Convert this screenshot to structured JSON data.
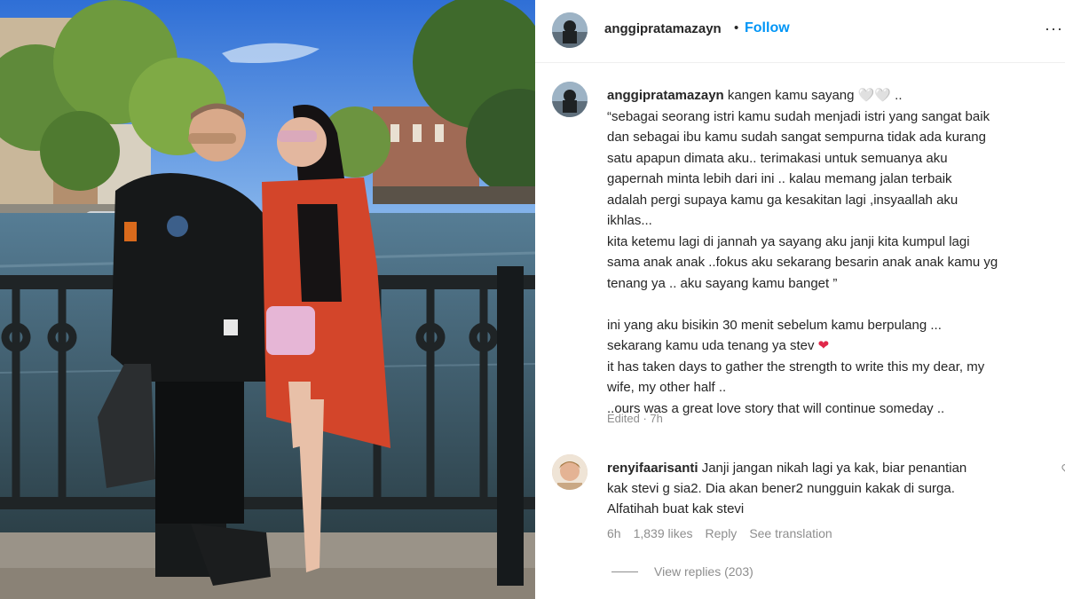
{
  "post": {
    "username": "anggipratamazayn",
    "follow_label": "Follow",
    "separator": "•",
    "more_icon": "more-icon"
  },
  "caption": {
    "username": "anggipratamazayn",
    "text": " kangen kamu sayang 🤍🤍 ..\n“sebagai seorang istri kamu sudah menjadi istri yang sangat baik\ndan sebagai ibu kamu sudah sangat sempurna tidak ada kurang\nsatu apapun dimata aku.. terimakasi untuk semuanya aku\ngapernah minta lebih dari ini .. kalau memang jalan terbaik\nadalah pergi supaya kamu ga kesakitan lagi ,insyaallah aku\nikhlas...\nkita ketemu lagi di jannah ya sayang aku janji kita kumpul lagi\nsama anak anak ..fokus aku sekarang besarin anak anak kamu yg\ntenang ya .. aku sayang kamu banget ”\n\nini yang aku bisikin 30 menit sebelum kamu berpulang ...\nsekarang kamu uda tenang ya stev ",
    "heart": "❤",
    "text_after": "\nit has taken days to gather the strength to write this my dear, my\nwife, my other half ..\n..ours was a great love story that will continue someday ..",
    "edited": "Edited · 7h"
  },
  "comment": {
    "username": "renyifaarisanti",
    "text": " Janji jangan nikah lagi ya kak, biar penantian\nkak stevi g sia2. Dia akan bener2 nungguin kakak di surga.\nAlfatihah buat kak stevi",
    "time": "6h",
    "likes": "1,839 likes",
    "reply_label": "Reply",
    "translate_label": "See translation",
    "like_icon": "heart-outline-icon"
  },
  "replies": {
    "label": "View replies (203)"
  },
  "colors": {
    "link": "#0095f6",
    "muted": "#8e8e8e",
    "text": "#262626",
    "heart": "#e0284a"
  }
}
